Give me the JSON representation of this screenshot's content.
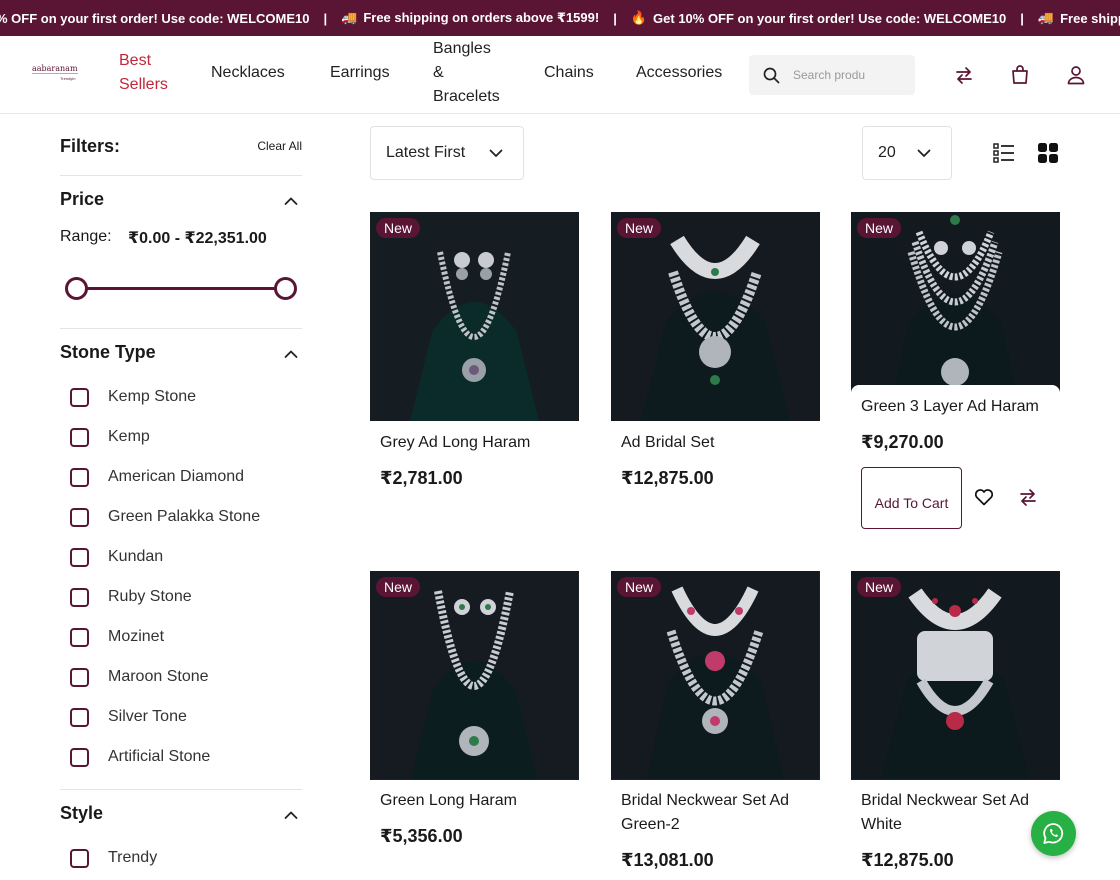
{
  "announcement": {
    "items": [
      {
        "emoji": "",
        "text": "% OFF on your first order! Use code: WELCOME10"
      },
      {
        "emoji": "🚚",
        "text": "Free shipping on orders above ₹1599!"
      },
      {
        "emoji": "🔥",
        "text": "Get 10% OFF on your first order! Use code: WELCOME10"
      },
      {
        "emoji": "🚚",
        "text": "Free shippi"
      }
    ],
    "separator": "|"
  },
  "header": {
    "logo": {
      "top": "aabaranam",
      "sub": "Trendyin"
    },
    "nav": [
      {
        "label": "Best Sellers",
        "active": true
      },
      {
        "label": "Necklaces"
      },
      {
        "label": "Earrings"
      },
      {
        "label": "Bangles & Bracelets"
      },
      {
        "label": "Chains"
      },
      {
        "label": "Accessories"
      }
    ],
    "search_placeholder": "Search produ"
  },
  "filters": {
    "title": "Filters:",
    "clear_all": "Clear All",
    "price": {
      "title": "Price",
      "range_label": "Range:",
      "range_value": "₹0.00 - ₹22,351.00",
      "min": 0.0,
      "max": 22351.0,
      "selected_min_fraction": 0.0,
      "selected_max_fraction": 1.0
    },
    "stone_type": {
      "title": "Stone Type",
      "options": [
        "Kemp Stone",
        "Kemp",
        "American Diamond",
        "Green Palakka Stone",
        "Kundan",
        "Ruby Stone",
        "Mozinet",
        "Maroon Stone",
        "Silver Tone",
        "Artificial Stone"
      ]
    },
    "style": {
      "title": "Style",
      "options": [
        "Trendy"
      ]
    }
  },
  "toolbar": {
    "sort": "Latest First",
    "per_page": "20",
    "view": "grid"
  },
  "products": [
    {
      "badge": "New",
      "name": "Grey Ad Long Haram",
      "price": "₹2,781.00"
    },
    {
      "badge": "New",
      "name": "Ad Bridal Set",
      "price": "₹12,875.00"
    },
    {
      "badge": "New",
      "name": "Green 3 Layer Ad Haram",
      "price": "₹9,270.00",
      "hover": true,
      "add_to_cart": "Add To Cart"
    },
    {
      "badge": "New",
      "name": "Green Long Haram",
      "price": "₹5,356.00"
    },
    {
      "badge": "New",
      "name": "Bridal Neckwear Set Ad Green-2",
      "price": "₹13,081.00"
    },
    {
      "badge": "New",
      "name": "Bridal Neckwear Set Ad White",
      "price": "₹12,875.00"
    }
  ],
  "colors": {
    "brand": "#5a1535",
    "active_nav": "#c0273a",
    "whatsapp": "#27b043"
  },
  "icons": [
    "search-icon",
    "compare-icon",
    "bag-icon",
    "user-icon",
    "chevron-up-icon",
    "chevron-down-icon",
    "list-view-icon",
    "grid-view-icon",
    "heart-icon",
    "whatsapp-icon"
  ]
}
